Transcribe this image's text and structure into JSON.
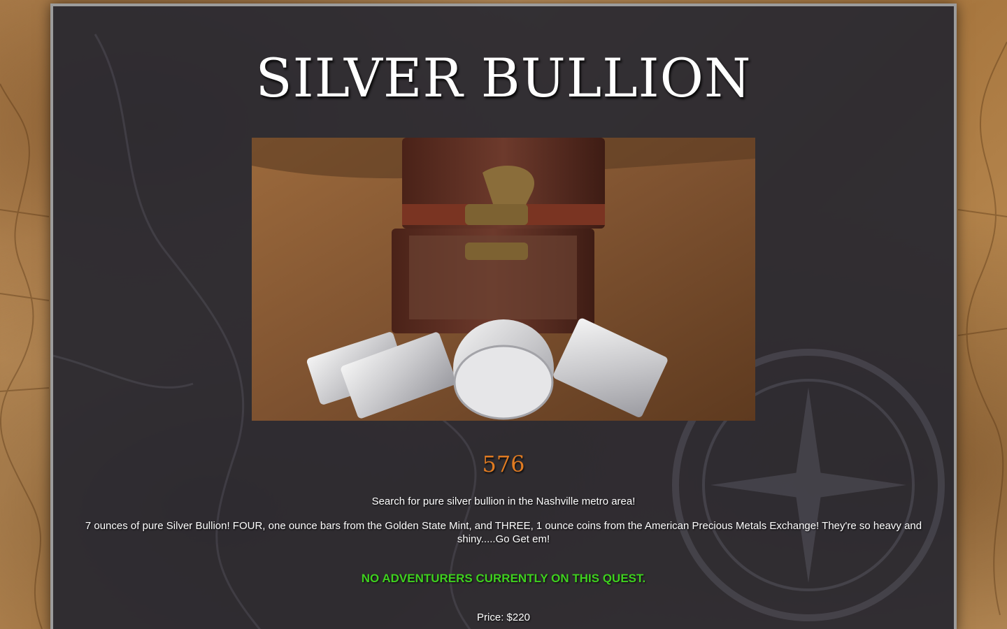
{
  "quest": {
    "title": "Silver Bullion",
    "number": "576",
    "summary": "Search for pure silver bullion in the Nashville metro area!",
    "description": "7 ounces of pure Silver Bullion! FOUR, one ounce bars from the Golden State Mint, and THREE, 1 ounce coins from the American Precious Metals Exchange! They're so heavy and shiny.....Go Get em!",
    "status": "No adventurers currently on this quest.",
    "price": "Price: $220"
  },
  "colors": {
    "panel": "#28283a",
    "number": "#e07b22",
    "status": "#3fd01f",
    "text": "#ffffff"
  }
}
